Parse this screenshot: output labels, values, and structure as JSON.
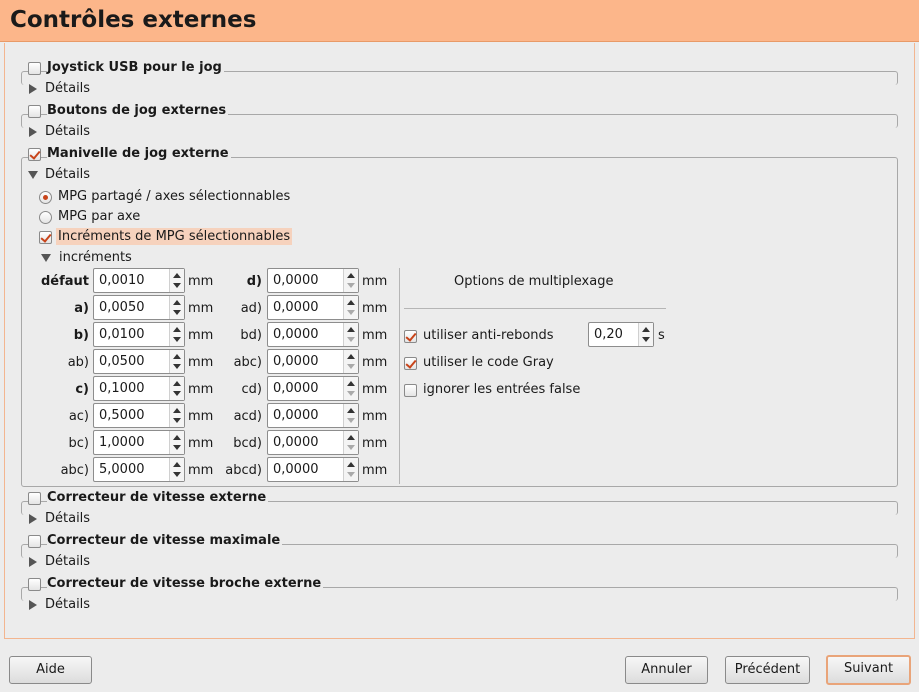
{
  "header": {
    "title": "Contrôles externes"
  },
  "sections": {
    "joystick": {
      "label": "Joystick USB pour le jog",
      "checked": false,
      "details": "Détails"
    },
    "jog_buttons": {
      "label": "Boutons de jog externes",
      "checked": false,
      "details": "Détails"
    },
    "mpg": {
      "label": "Manivelle de jog externe",
      "checked": true,
      "details": "Détails",
      "radio_shared": "MPG partagé / axes sélectionnables",
      "radio_per_axis": "MPG par axe",
      "selectable_increments": "Incréments de MPG sélectionnables",
      "increments_expander": "incréments",
      "unit": "mm",
      "increments_left": [
        {
          "label": "défaut",
          "value": "0,0010",
          "bold": true
        },
        {
          "label": "a)",
          "value": "0,0050",
          "bold": true
        },
        {
          "label": "b)",
          "value": "0,0100",
          "bold": true
        },
        {
          "label": "ab)",
          "value": "0,0500",
          "bold": false
        },
        {
          "label": "c)",
          "value": "0,1000",
          "bold": true
        },
        {
          "label": "ac)",
          "value": "0,5000",
          "bold": false
        },
        {
          "label": "bc)",
          "value": "1,0000",
          "bold": false
        },
        {
          "label": "abc)",
          "value": "5,0000",
          "bold": false
        }
      ],
      "increments_right": [
        {
          "label": "d)",
          "value": "0,0000",
          "bold": true
        },
        {
          "label": "ad)",
          "value": "0,0000",
          "bold": false
        },
        {
          "label": "bd)",
          "value": "0,0000",
          "bold": false
        },
        {
          "label": "abc)",
          "value": "0,0000",
          "bold": false
        },
        {
          "label": "cd)",
          "value": "0,0000",
          "bold": false
        },
        {
          "label": "acd)",
          "value": "0,0000",
          "bold": false
        },
        {
          "label": "bcd)",
          "value": "0,0000",
          "bold": false
        },
        {
          "label": "abcd)",
          "value": "0,0000",
          "bold": false
        }
      ],
      "multiplex": {
        "title": "Options de multiplexage",
        "debounce_label": "utiliser anti-rebonds",
        "debounce_value": "0,20",
        "debounce_unit": "s",
        "gray_code": "utiliser le code Gray",
        "ignore_false": "ignorer les entrées false"
      }
    },
    "feed_override": {
      "label": "Correcteur de vitesse externe",
      "checked": false,
      "details": "Détails"
    },
    "max_velocity": {
      "label": "Correcteur de vitesse maximale",
      "checked": false,
      "details": "Détails"
    },
    "spindle_override": {
      "label": "Correcteur de vitesse broche externe",
      "checked": false,
      "details": "Détails"
    }
  },
  "buttons": {
    "help": "Aide",
    "cancel": "Annuler",
    "previous": "Précédent",
    "next": "Suivant"
  },
  "colors": {
    "header_bg": "#fcb68a",
    "accent": "#c8441a"
  }
}
